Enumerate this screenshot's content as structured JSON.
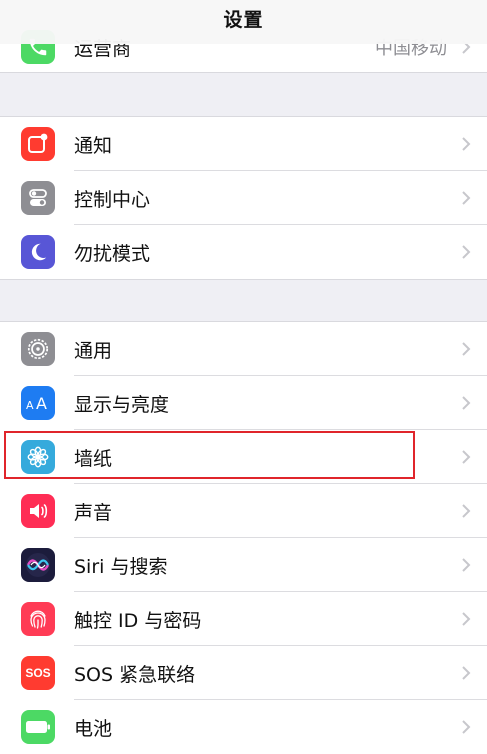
{
  "nav": {
    "title": "设置"
  },
  "colors": {
    "background": "#efeff4",
    "highlight": "#e0252b",
    "chevron": "#c7c7cc"
  },
  "top_group": [
    {
      "label": "运营商",
      "value": "中国移动",
      "icon": "phone-icon",
      "color": "#4cd964"
    }
  ],
  "group2": [
    {
      "label": "通知",
      "icon": "notifications-icon",
      "color": "#ff3b30"
    },
    {
      "label": "控制中心",
      "icon": "control-center-icon",
      "color": "#8e8e93"
    },
    {
      "label": "勿扰模式",
      "icon": "moon-icon",
      "color": "#5856d6"
    }
  ],
  "group3": [
    {
      "label": "通用",
      "icon": "gear-icon",
      "color": "#8e8e93"
    },
    {
      "label": "显示与亮度",
      "icon": "text-size-icon",
      "color": "#1e7cf2"
    },
    {
      "label": "墙纸",
      "icon": "flower-icon",
      "color": "#35aadc"
    },
    {
      "label": "声音",
      "icon": "speaker-icon",
      "color": "#ff2d55"
    },
    {
      "label": "Siri 与搜索",
      "icon": "siri-icon",
      "color": "#1c1c3c"
    },
    {
      "label": "触控 ID 与密码",
      "icon": "fingerprint-icon",
      "color": "#ff3b55"
    },
    {
      "label": "SOS 紧急联络",
      "icon": "sos-icon",
      "color": "#ff3b30",
      "icon_text": "SOS"
    },
    {
      "label": "电池",
      "icon": "battery-icon",
      "color": "#4cd964"
    }
  ]
}
